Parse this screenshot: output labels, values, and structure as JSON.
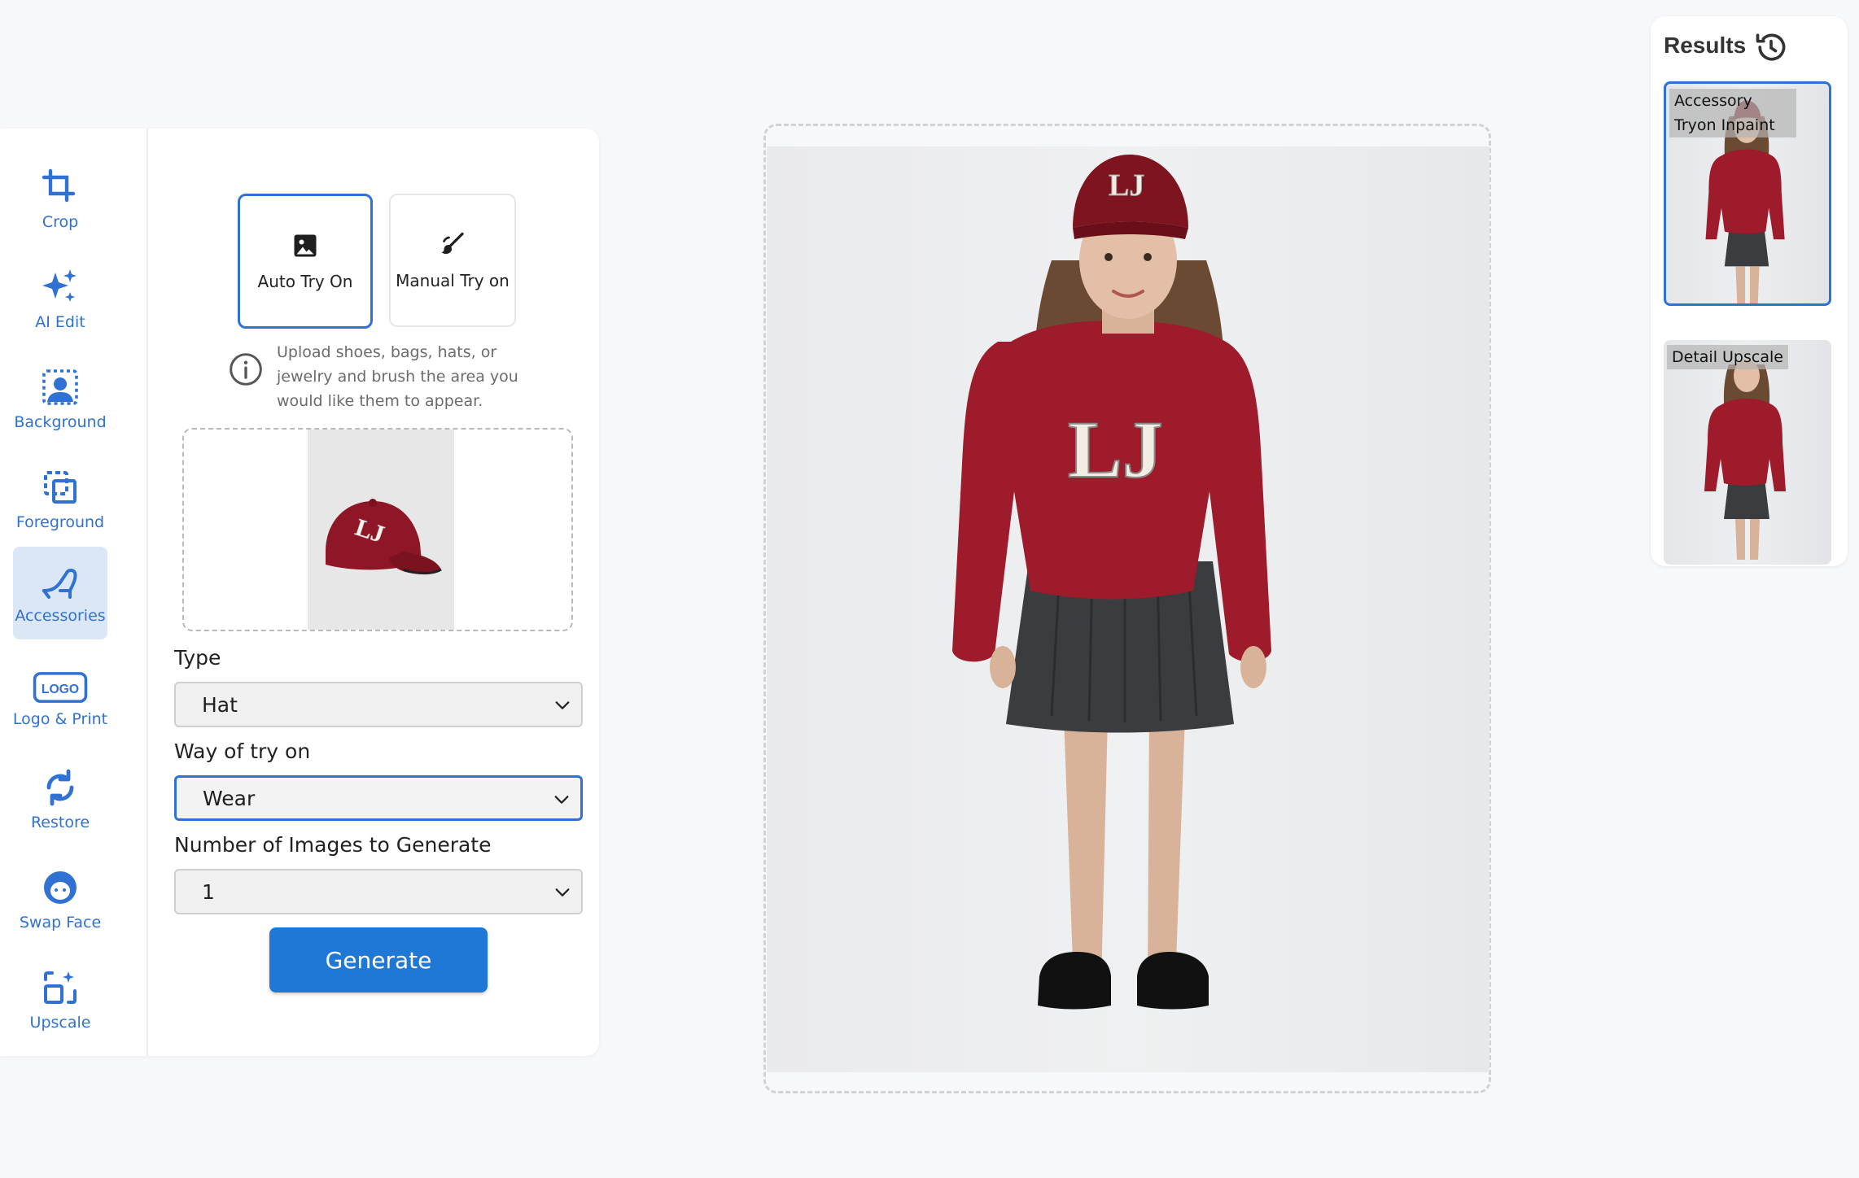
{
  "tools": [
    {
      "name": "crop",
      "label": "Crop",
      "icon": "crop-icon",
      "active": false
    },
    {
      "name": "ai-edit",
      "label": "AI Edit",
      "icon": "sparkles-icon",
      "active": false
    },
    {
      "name": "background",
      "label": "Background",
      "icon": "background-icon",
      "active": false
    },
    {
      "name": "foreground",
      "label": "Foreground",
      "icon": "foreground-icon",
      "active": false
    },
    {
      "name": "accessories",
      "label": "Accessories",
      "icon": "high-heel-icon",
      "active": true
    },
    {
      "name": "logo-print",
      "label": "Logo & Print",
      "icon": "logo-icon",
      "active": false
    },
    {
      "name": "restore",
      "label": "Restore",
      "icon": "restore-icon",
      "active": false
    },
    {
      "name": "swap-face",
      "label": "Swap Face",
      "icon": "face-icon",
      "active": false
    },
    {
      "name": "upscale",
      "label": "Upscale",
      "icon": "upscale-icon",
      "active": false
    }
  ],
  "logo_badge_text": "LOGO",
  "modes": {
    "auto_label": "Auto Try On",
    "manual_label": "Manual Try on",
    "selected": "Auto Try On"
  },
  "hint": "Upload shoes, bags, hats, or jewelry and brush the area you would like them to appear.",
  "form": {
    "type_label": "Type",
    "type_value": "Hat",
    "way_label": "Way of try on",
    "way_value": "Wear",
    "count_label": "Number of Images to Generate",
    "count_value": "1"
  },
  "generate_label": "Generate",
  "results": {
    "title": "Results",
    "items": [
      {
        "label": "Accessory Tryon Inpaint",
        "selected": true
      },
      {
        "label": "Detail Upscale",
        "selected": false
      }
    ]
  },
  "colors": {
    "accent": "#2f72d4",
    "button": "#1f77d6",
    "sweater": "#9e1b2b",
    "skirt": "#3a3c40"
  }
}
